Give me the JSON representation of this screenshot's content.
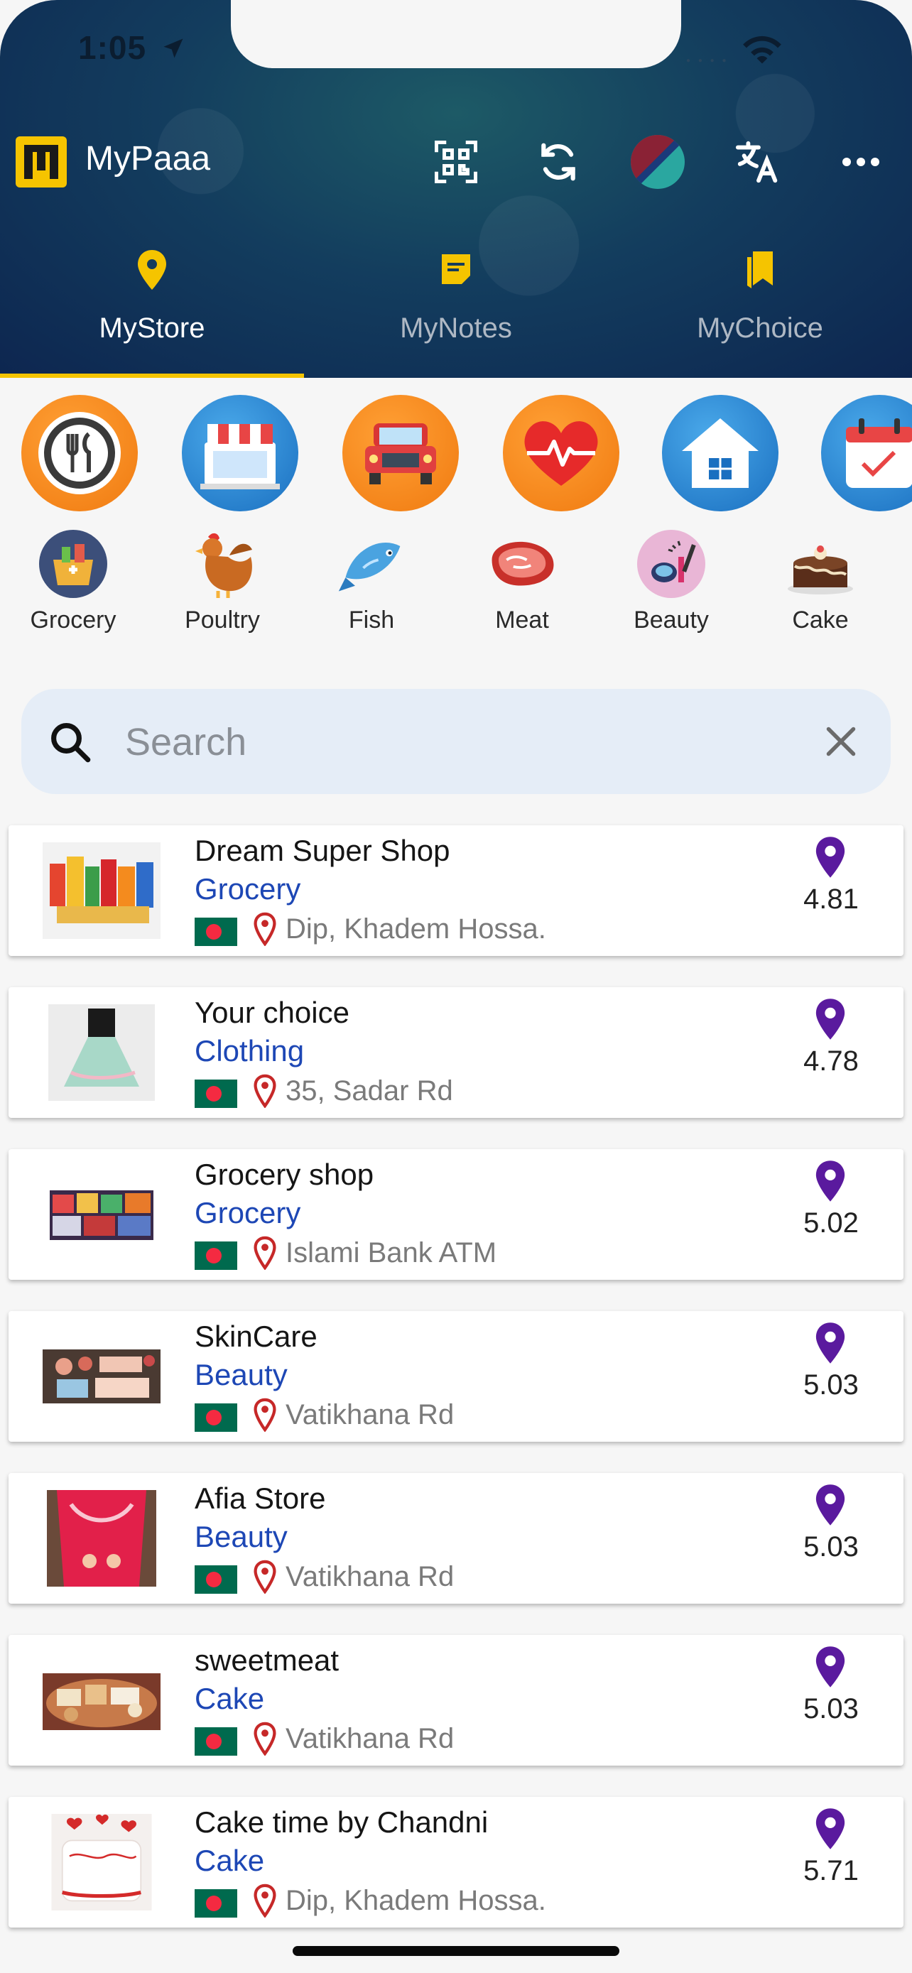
{
  "status": {
    "time": "1:05"
  },
  "header": {
    "title": "MyPaaa"
  },
  "tabs": [
    {
      "label": "MyStore",
      "active": true
    },
    {
      "label": "MyNotes",
      "active": false
    },
    {
      "label": "MyChoice",
      "active": false
    }
  ],
  "categories": [
    "restaurant-icon",
    "shop-icon",
    "car-icon",
    "health-icon",
    "home-icon",
    "calendar-icon"
  ],
  "subcategories": [
    {
      "label": "Grocery",
      "icon": "grocery-basket-icon"
    },
    {
      "label": "Poultry",
      "icon": "chicken-icon"
    },
    {
      "label": "Fish",
      "icon": "fish-icon"
    },
    {
      "label": "Meat",
      "icon": "meat-icon"
    },
    {
      "label": "Beauty",
      "icon": "makeup-icon"
    },
    {
      "label": "Cake",
      "icon": "cake-icon"
    }
  ],
  "search": {
    "placeholder": "Search",
    "value": ""
  },
  "stores": [
    {
      "name": "Dream Super Shop",
      "category": "Grocery",
      "address": "Dip, Khadem Hossa.",
      "rating": "4.81"
    },
    {
      "name": "Your choice",
      "category": "Clothing",
      "address": "35, Sadar Rd",
      "rating": "4.78"
    },
    {
      "name": "Grocery shop",
      "category": "Grocery",
      "address": "Islami Bank ATM",
      "rating": "5.02"
    },
    {
      "name": "SkinCare",
      "category": "Beauty",
      "address": "Vatikhana Rd",
      "rating": "5.03"
    },
    {
      "name": "Afia Store",
      "category": "Beauty",
      "address": "Vatikhana Rd",
      "rating": "5.03"
    },
    {
      "name": "sweetmeat",
      "category": "Cake",
      "address": "Vatikhana Rd",
      "rating": "5.03"
    },
    {
      "name": "Cake time by Chandni",
      "category": "Cake",
      "address": "Dip, Khadem Hossa.",
      "rating": "5.71"
    }
  ],
  "colors": {
    "accent": "#f5c400",
    "category_text": "#1d47b5",
    "rating_pin": "#5a1a9e",
    "address_pin": "#c62828",
    "header_bg": "#133d5e"
  }
}
